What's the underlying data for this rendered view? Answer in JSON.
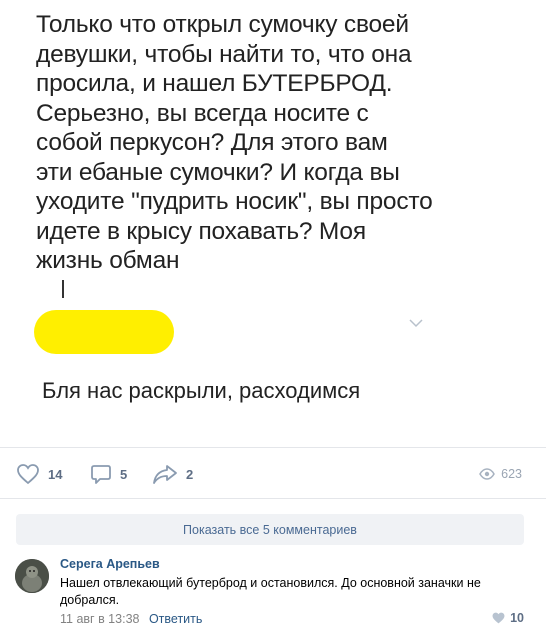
{
  "post": {
    "text_lines": [
      "Только что открыл сумочку своей",
      "девушки, чтобы найти то, что она",
      "просила, и нашел БУТЕРБРОД.",
      "Серьезно, вы всегда носите с",
      "собой перкусон? Для этого вам",
      "эти ебаные сумочки? И когда вы",
      "уходите \"пудрить носик\", вы просто",
      "идете в крысу похавать? Моя",
      "жизнь обман"
    ],
    "reply_text": "Бля нас раскрыли, расходимся",
    "highlight_color": "#ffef00"
  },
  "actions": {
    "likes": "14",
    "comments": "5",
    "shares": "2",
    "views": "623"
  },
  "comments_section": {
    "show_all_label": "Показать все 5 комментариев",
    "comment": {
      "author": "Серега Арепьев",
      "text": "Нашел отвлекающий бутерброд и остановился. До основной заначки не добрался.",
      "date": "11 авг в 13:38",
      "reply_label": "Ответить",
      "likes": "10"
    }
  },
  "icons": [
    "heart-icon",
    "comment-icon",
    "share-icon",
    "eye-icon",
    "chevron-down-icon"
  ],
  "colors": {
    "link": "#2a5885",
    "icon": "#5e6e85",
    "button_bg": "#f0f2f5"
  }
}
